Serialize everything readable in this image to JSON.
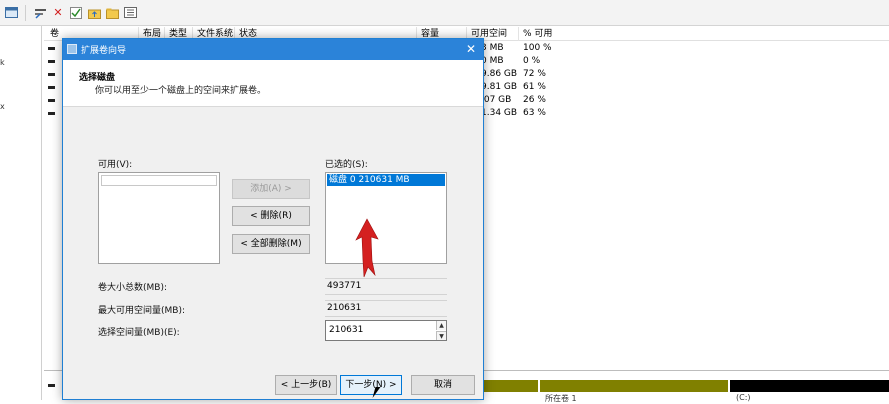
{
  "toolbar": {
    "icons": [
      "window-icon",
      "properties-icon",
      "delete-icon",
      "check-icon",
      "folder-up-icon",
      "folder-icon",
      "list-icon"
    ]
  },
  "left_strip": {
    "items": [
      "k",
      "x"
    ]
  },
  "list": {
    "columns": [
      "卷",
      "布局",
      "类型",
      "文件系统",
      "状态",
      "容量",
      "可用空间",
      "% 可用"
    ],
    "rows": [
      {
        "free": "3 MB",
        "pct": "100 %"
      },
      {
        "free": "0 MB",
        "pct": "0 %"
      },
      {
        "free": "9.86 GB",
        "pct": "72 %"
      },
      {
        "free": "9.81 GB",
        "pct": "61 %"
      },
      {
        "free": ".07 GB",
        "pct": "26 %"
      },
      {
        "free": "1.34 GB",
        "pct": "63 %"
      }
    ]
  },
  "bottom": {
    "labels": [
      "所在卷 1",
      "(C:)"
    ]
  },
  "dialog": {
    "title": "扩展卷向导",
    "close": "✕",
    "header_title": "选择磁盘",
    "header_subtitle": "你可以用至少一个磁盘上的空间来扩展卷。",
    "available_label": "可用(V):",
    "selected_label": "已选的(S):",
    "selected_items": [
      "磁盘 0     210631 MB"
    ],
    "add_button": "添加(A) >",
    "remove_button": "< 删除(R)",
    "remove_all_button": "< 全部删除(M)",
    "total_size_label": "卷大小总数(MB):",
    "total_size_value": "493771",
    "max_space_label": "最大可用空间量(MB):",
    "max_space_value": "210631",
    "select_space_label": "选择空间量(MB)(E):",
    "select_space_value": "210631",
    "back_button": "< 上一步(B)",
    "next_button": "下一步(N) >",
    "cancel_button": "取消"
  },
  "colors": {
    "title_bar": "#2b83d9",
    "selection": "#0078d7",
    "arrow": "#d42020",
    "disk_olive": "#808000"
  }
}
